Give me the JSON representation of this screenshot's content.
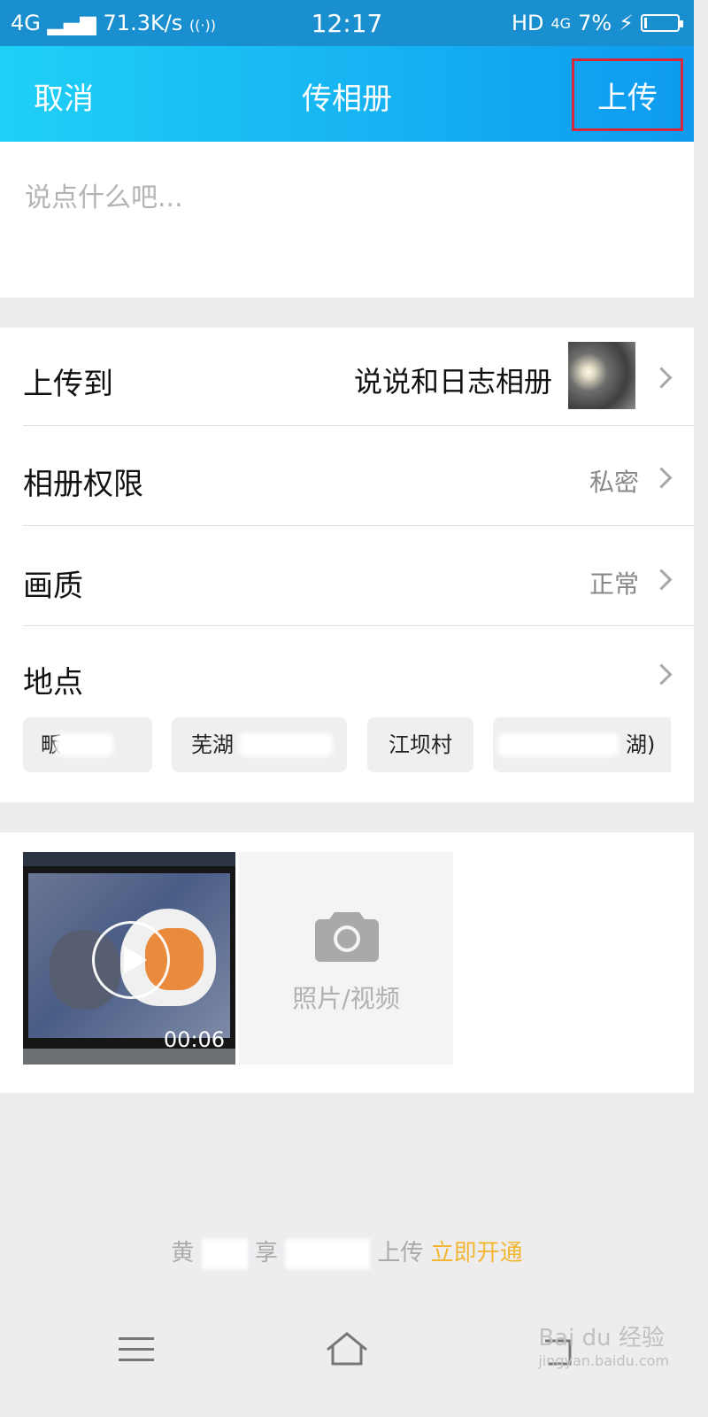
{
  "status_bar": {
    "network": "4G",
    "speed": "71.3K/s",
    "time": "12:17",
    "hd": "HD",
    "net2": "4G",
    "battery": "7%"
  },
  "nav": {
    "cancel": "取消",
    "title": "传相册",
    "upload": "上传"
  },
  "compose": {
    "placeholder": "说点什么吧..."
  },
  "settings": {
    "upload_to": {
      "label": "上传到",
      "value": "说说和日志相册"
    },
    "permission": {
      "label": "相册权限",
      "value": "私密"
    },
    "quality": {
      "label": "画质",
      "value": "正常"
    },
    "location": {
      "label": "地点"
    }
  },
  "location_chips": [
    "畈",
    "芜湖",
    "江坝村",
    "湖)"
  ],
  "media": {
    "video_duration": "00:06",
    "add_label": "照片/视频"
  },
  "promo": {
    "text_a": "黄",
    "text_b": "享",
    "text_c": "上传",
    "link": "立即开通"
  },
  "watermark": {
    "text": "Bai du 经验",
    "url": "jingyan.baidu.com"
  },
  "colors": {
    "nav_gradient_start": "#1fd0f6",
    "nav_gradient_end": "#0e9aef",
    "highlight_box": "#d5283a",
    "promo_link": "#f2b632"
  }
}
